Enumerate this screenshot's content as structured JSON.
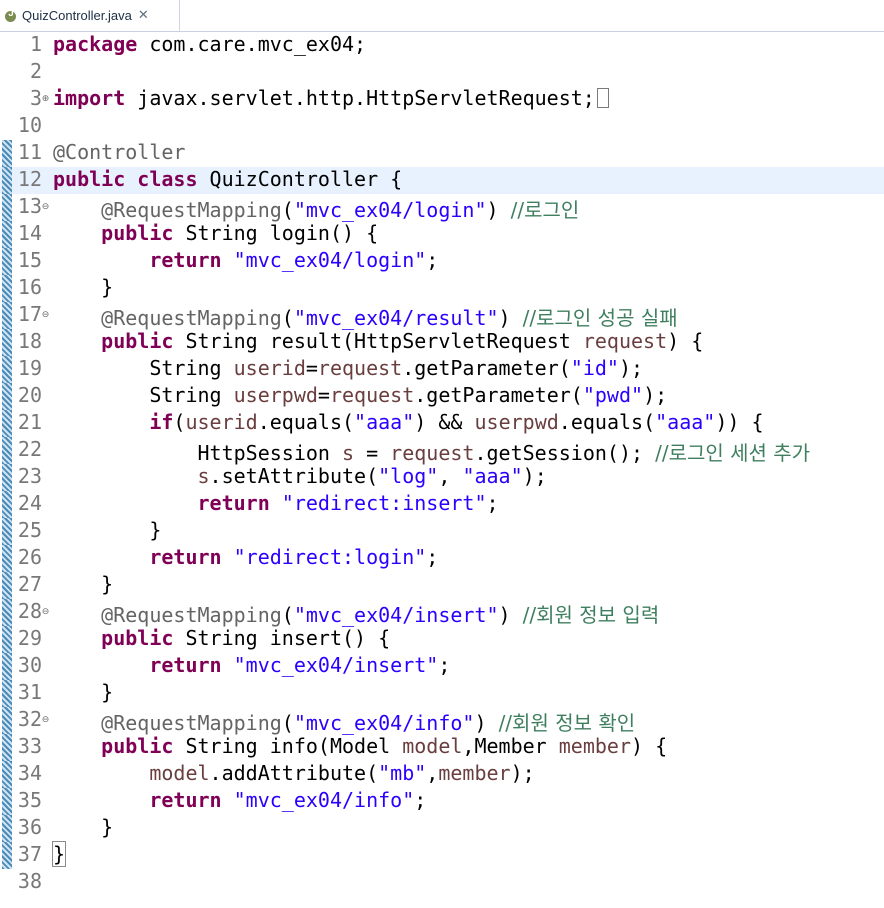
{
  "tab": {
    "title": "QuizController.java",
    "close": "✕",
    "icon_letter": "J"
  },
  "lines": [
    {
      "n": "1"
    },
    {
      "n": "2"
    },
    {
      "n": "3"
    },
    {
      "n": "10"
    },
    {
      "n": "11"
    },
    {
      "n": "12"
    },
    {
      "n": "13"
    },
    {
      "n": "14"
    },
    {
      "n": "15"
    },
    {
      "n": "16"
    },
    {
      "n": "17"
    },
    {
      "n": "18"
    },
    {
      "n": "19"
    },
    {
      "n": "20"
    },
    {
      "n": "21"
    },
    {
      "n": "22"
    },
    {
      "n": "23"
    },
    {
      "n": "24"
    },
    {
      "n": "25"
    },
    {
      "n": "26"
    },
    {
      "n": "27"
    },
    {
      "n": "28"
    },
    {
      "n": "29"
    },
    {
      "n": "30"
    },
    {
      "n": "31"
    },
    {
      "n": "32"
    },
    {
      "n": "33"
    },
    {
      "n": "34"
    },
    {
      "n": "35"
    },
    {
      "n": "36"
    },
    {
      "n": "37"
    },
    {
      "n": "38"
    }
  ],
  "code": {
    "l1_kw": "package",
    "l1_rest": " com.care.mvc_ex04;",
    "l3_kw": "import",
    "l3_rest": " javax.servlet.http.HttpServletRequest;",
    "l11_ann": "@Controller",
    "l12_kw1": "public",
    "l12_kw2": "class",
    "l12_rest": " QuizController {",
    "l13_ann": "@RequestMapping",
    "l13_str": "\"mvc_ex04/login\"",
    "l13_com": "//로그인",
    "l14_kw": "public",
    "l14_rest": " String login() {",
    "l15_kw": "return",
    "l15_str": "\"mvc_ex04/login\"",
    "l16": "}",
    "l17_ann": "@RequestMapping",
    "l17_str": "\"mvc_ex04/result\"",
    "l17_com": "//로그인 성공 실패",
    "l18_kw": "public",
    "l18_a": " String result(HttpServletRequest ",
    "l18_var": "request",
    "l18_b": ") {",
    "l19_a": "String ",
    "l19_v1": "userid",
    "l19_b": "=",
    "l19_v2": "request",
    "l19_c": ".getParameter(",
    "l19_str": "\"id\"",
    "l19_d": ");",
    "l20_a": "String ",
    "l20_v1": "userpwd",
    "l20_b": "=",
    "l20_v2": "request",
    "l20_c": ".getParameter(",
    "l20_str": "\"pwd\"",
    "l20_d": ");",
    "l21_kw": "if",
    "l21_a": "(",
    "l21_v1": "userid",
    "l21_b": ".equals(",
    "l21_s1": "\"aaa\"",
    "l21_c": ") && ",
    "l21_v2": "userpwd",
    "l21_d": ".equals(",
    "l21_s2": "\"aaa\"",
    "l21_e": ")) {",
    "l22_a": "HttpSession ",
    "l22_v1": "s",
    "l22_b": " = ",
    "l22_v2": "request",
    "l22_c": ".getSession(); ",
    "l22_com": "//로그인 세션 추가",
    "l23_v": "s",
    "l23_a": ".setAttribute(",
    "l23_s1": "\"log\"",
    "l23_b": ", ",
    "l23_s2": "\"aaa\"",
    "l23_c": ");",
    "l24_kw": "return",
    "l24_str": "\"redirect:insert\"",
    "l25": "}",
    "l26_kw": "return",
    "l26_str": "\"redirect:login\"",
    "l27": "}",
    "l28_ann": "@RequestMapping",
    "l28_str": "\"mvc_ex04/insert\"",
    "l28_com": "//회원 정보 입력",
    "l29_kw": "public",
    "l29_rest": " String insert() {",
    "l30_kw": "return",
    "l30_str": "\"mvc_ex04/insert\"",
    "l31": "}",
    "l32_ann": "@RequestMapping",
    "l32_str": "\"mvc_ex04/info\"",
    "l32_com": "//회원 정보 확인",
    "l33_kw": "public",
    "l33_a": " String info(Model ",
    "l33_v1": "model",
    "l33_b": ",Member ",
    "l33_v2": "member",
    "l33_c": ") {",
    "l34_v1": "model",
    "l34_a": ".addAttribute(",
    "l34_str": "\"mb\"",
    "l34_b": ",",
    "l34_v2": "member",
    "l34_c": ");",
    "l35_kw": "return",
    "l35_str": "\"mvc_ex04/info\"",
    "l36": "}",
    "l37": "}"
  },
  "colors": {
    "keyword": "#7f0055",
    "string": "#2a00ff",
    "comment": "#3f7f5f",
    "annotation": "#646464",
    "variable": "#6a3e3e",
    "current_line": "#e8f2fe"
  }
}
